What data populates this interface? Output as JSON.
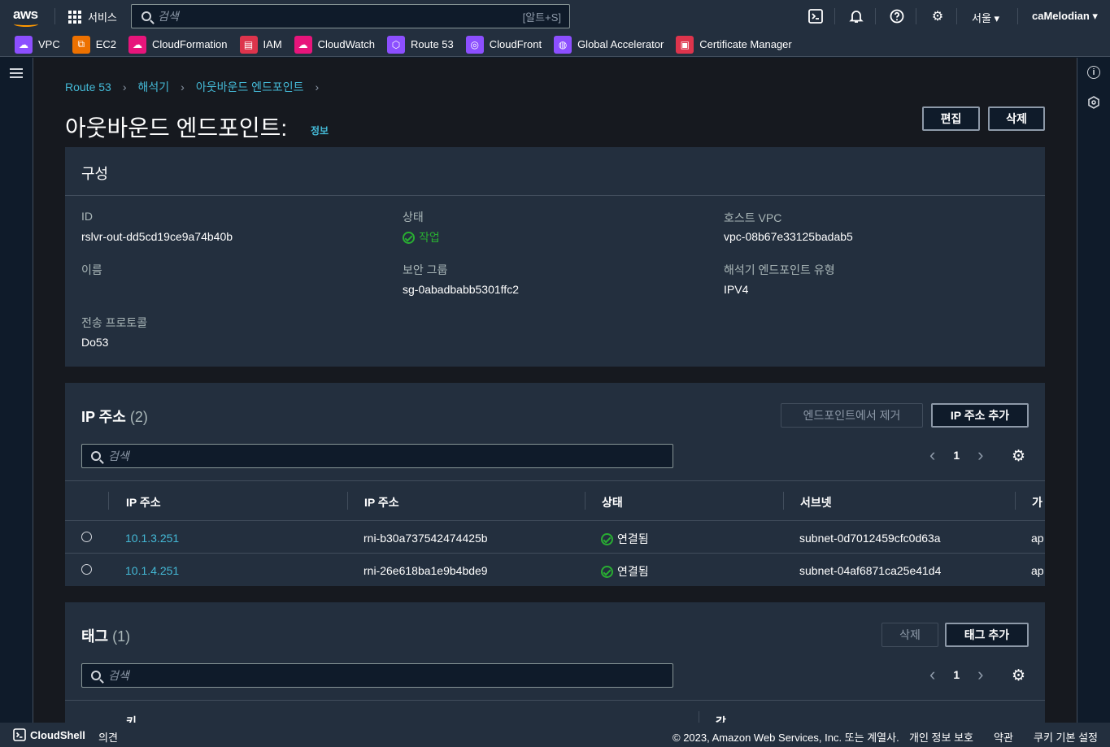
{
  "top": {
    "logo": "aws",
    "services": "서비스",
    "search_placeholder": "검색",
    "search_shortcut": "[알트+S]",
    "region": "서울 ▾",
    "user": "caMelodian ▾"
  },
  "favorites": [
    {
      "label": "VPC",
      "color": "#8c4fff"
    },
    {
      "label": "EC2",
      "color": "#ed7100"
    },
    {
      "label": "CloudFormation",
      "color": "#e7157b"
    },
    {
      "label": "IAM",
      "color": "#dd344c"
    },
    {
      "label": "CloudWatch",
      "color": "#e7157b"
    },
    {
      "label": "Route 53",
      "color": "#8c4fff"
    },
    {
      "label": "CloudFront",
      "color": "#8c4fff"
    },
    {
      "label": "Global Accelerator",
      "color": "#8c4fff"
    },
    {
      "label": "Certificate Manager",
      "color": "#dd344c"
    }
  ],
  "breadcrumb": [
    "Route 53",
    "해석기",
    "아웃바운드 엔드포인트"
  ],
  "page": {
    "title": "아웃바운드 엔드포인트:",
    "info": "정보",
    "edit": "편집",
    "delete": "삭제"
  },
  "config": {
    "heading": "구성",
    "id_label": "ID",
    "id_value": "rslvr-out-dd5cd19ce9a74b40b",
    "status_label": "상태",
    "status_value": "작업",
    "vpc_label": "호스트 VPC",
    "vpc_value": "vpc-08b67e33125badab5",
    "name_label": "이름",
    "sg_label": "보안 그룹",
    "sg_value": "sg-0abadbabb5301ffc2",
    "type_label": "해석기 엔드포인트 유형",
    "type_value": "IPV4",
    "protocol_label": "전송 프로토콜",
    "protocol_value": "Do53"
  },
  "ip": {
    "heading": "IP 주소",
    "count": "(2)",
    "remove": "엔드포인트에서 제거",
    "add": "IP 주소 추가",
    "search_placeholder": "검색",
    "page": "1",
    "columns": [
      "IP 주소",
      "IP 주소",
      "상태",
      "서브넷",
      "가"
    ],
    "rows": [
      {
        "ip": "10.1.3.251",
        "eni": "rni-b30a737542474425b",
        "status": "연결됨",
        "subnet": "subnet-0d7012459cfc0d63a",
        "az": "ap"
      },
      {
        "ip": "10.1.4.251",
        "eni": "rni-26e618ba1e9b4bde9",
        "status": "연결됨",
        "subnet": "subnet-04af6871ca25e41d4",
        "az": "ap"
      }
    ]
  },
  "tags": {
    "heading": "태그",
    "count": "(1)",
    "delete": "삭제",
    "add": "태그 추가",
    "search_placeholder": "검색",
    "page": "1",
    "col_key": "키",
    "col_value": "값"
  },
  "footer": {
    "cloudshell": "CloudShell",
    "feedback": "의견",
    "copyright": "© 2023, Amazon Web Services, Inc. 또는 계열사.",
    "privacy": "개인 정보 보호",
    "terms": "약관",
    "cookies": "쿠키 기본 설정"
  }
}
